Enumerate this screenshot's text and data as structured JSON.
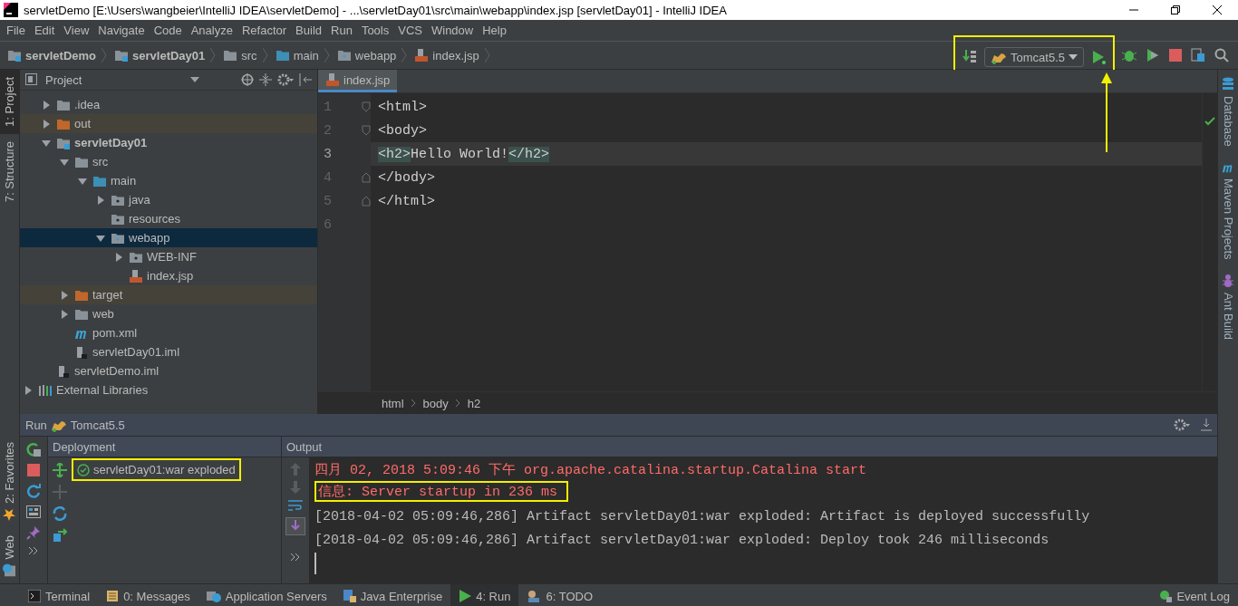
{
  "window": {
    "title": "servletDemo [E:\\Users\\wangbeier\\IntelliJ IDEA\\servletDemo] - ...\\servletDay01\\src\\main\\webapp\\index.jsp [servletDay01] - IntelliJ IDEA"
  },
  "menu": [
    "File",
    "Edit",
    "View",
    "Navigate",
    "Code",
    "Analyze",
    "Refactor",
    "Build",
    "Run",
    "Tools",
    "VCS",
    "Window",
    "Help"
  ],
  "breadcrumbs": [
    {
      "label": "servletDemo",
      "kind": "module"
    },
    {
      "label": "servletDay01",
      "kind": "module"
    },
    {
      "label": "src",
      "kind": "folder"
    },
    {
      "label": "main",
      "kind": "source"
    },
    {
      "label": "webapp",
      "kind": "web"
    },
    {
      "label": "index.jsp",
      "kind": "jsp"
    }
  ],
  "run_config": {
    "label": "Tomcat5.5"
  },
  "left_tool_tabs": [
    {
      "label": "1: Project",
      "selected": true
    },
    {
      "label": "7: Structure",
      "selected": false
    }
  ],
  "left_tool_tabs_bottom": [
    {
      "label": "2: Favorites",
      "kind": "favorites"
    },
    {
      "label": "Web",
      "kind": "web"
    }
  ],
  "project_panel": {
    "title": "Project",
    "tree": [
      {
        "children": [
          {
            "label": ".idea",
            "kind": "folder",
            "expanded": false,
            "selected": false,
            "excluded": false
          },
          {
            "label": "out",
            "kind": "folder",
            "expanded": false,
            "selected": false,
            "excluded": true
          },
          {
            "label": "servletDay01",
            "kind": "module",
            "expanded": true,
            "selected": false,
            "excluded": false,
            "children": [
              {
                "label": "src",
                "kind": "folder",
                "expanded": true,
                "selected": false,
                "excluded": false,
                "children": [
                  {
                    "label": "main",
                    "kind": "source",
                    "expanded": true,
                    "selected": false,
                    "excluded": false,
                    "children": [
                      {
                        "label": "java",
                        "kind": "package",
                        "expanded": false,
                        "selected": false,
                        "excluded": false
                      },
                      {
                        "label": "resources",
                        "kind": "package",
                        "selected": false,
                        "excluded": false
                      },
                      {
                        "label": "webapp",
                        "kind": "web",
                        "expanded": true,
                        "selected": true,
                        "excluded": false,
                        "children": [
                          {
                            "label": "WEB-INF",
                            "kind": "package",
                            "expanded": false,
                            "selected": false,
                            "excluded": false
                          },
                          {
                            "label": "index.jsp",
                            "kind": "jsp",
                            "selected": false
                          }
                        ]
                      }
                    ]
                  }
                ]
              },
              {
                "label": "target",
                "kind": "folder",
                "expanded": false,
                "selected": false,
                "excluded": true
              },
              {
                "label": "web",
                "kind": "folder",
                "expanded": false,
                "selected": false,
                "excluded": false
              },
              {
                "label": "pom.xml",
                "kind": "maven",
                "selected": false
              },
              {
                "label": "servletDay01.iml",
                "kind": "iml",
                "selected": false
              }
            ]
          },
          {
            "label": "servletDemo.iml",
            "kind": "iml",
            "selected": false
          }
        ]
      },
      {
        "label": "External Libraries",
        "kind": "libraries",
        "expanded": false,
        "selected": false
      }
    ]
  },
  "editor": {
    "tabs": [
      {
        "label": "index.jsp",
        "selected": true
      }
    ],
    "lines": [
      {
        "number": "1",
        "current": false,
        "fold": {
          "kind": "start"
        },
        "segments": [
          {
            "text": "<html>",
            "kind": "tag"
          }
        ]
      },
      {
        "number": "2",
        "current": false,
        "fold": {
          "kind": "start"
        },
        "segments": [
          {
            "text": "<body>",
            "kind": "tag"
          }
        ]
      },
      {
        "number": "3",
        "current": true,
        "segments": [
          {
            "text": "<h2>",
            "kind": "tag_match"
          },
          {
            "text": "Hello World!",
            "kind": "text"
          },
          {
            "text": "</h2>",
            "kind": "tag_match"
          }
        ]
      },
      {
        "number": "4",
        "current": false,
        "fold": {
          "kind": "end"
        },
        "segments": [
          {
            "text": "</body>",
            "kind": "tag"
          }
        ]
      },
      {
        "number": "5",
        "current": false,
        "fold": {
          "kind": "end"
        },
        "segments": [
          {
            "text": "</html>",
            "kind": "tag"
          }
        ]
      },
      {
        "number": "6",
        "current": false
      }
    ],
    "breadcrumbs": [
      "html",
      "body",
      "h2"
    ]
  },
  "right_tool_tabs": [
    {
      "label": "Database",
      "kind": "database"
    },
    {
      "label": "Maven Projects",
      "kind": "maven"
    },
    {
      "label": "Ant Build",
      "kind": "ant"
    }
  ],
  "run_panel": {
    "title": "Run",
    "config": "Tomcat5.5",
    "deployment": {
      "title": "Deployment",
      "items": [
        {
          "label": "servletDay01:war exploded",
          "deployed": true
        }
      ]
    },
    "output": {
      "title": "Output",
      "lines": [
        {
          "text": "四月 02, 2018 5:09:46 下午 org.apache.catalina.startup.Catalina start",
          "kind": "error",
          "highlighted": false
        },
        {
          "text": "信息: Server startup in 236 ms",
          "kind": "error",
          "highlighted": true
        },
        {
          "text": "[2018-04-02 05:09:46,286] Artifact servletDay01:war exploded: Artifact is deployed successfully",
          "kind": "normal",
          "highlighted": false
        },
        {
          "text": "[2018-04-02 05:09:46,286] Artifact servletDay01:war exploded: Deploy took 246 milliseconds",
          "kind": "normal",
          "highlighted": false
        }
      ]
    }
  },
  "bottom_tabs": [
    {
      "label": "Terminal",
      "kind": "terminal",
      "selected": false
    },
    {
      "label": "0: Messages",
      "kind": "messages",
      "selected": false
    },
    {
      "label": "Application Servers",
      "kind": "servers",
      "selected": false
    },
    {
      "label": "Java Enterprise",
      "kind": "enterprise",
      "selected": false
    },
    {
      "label": "4: Run",
      "kind": "run",
      "selected": true
    },
    {
      "label": "6: TODO",
      "kind": "todo",
      "selected": false
    }
  ],
  "event_log": {
    "label": "Event Log"
  }
}
